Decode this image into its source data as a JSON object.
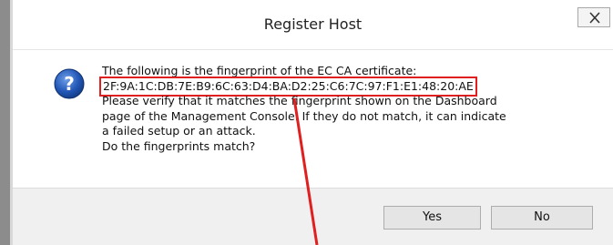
{
  "dialog": {
    "title": "Register Host",
    "close_symbol": "X",
    "icon": "question-icon",
    "message_lines": [
      "The following is the fingerprint of the EC CA certificate:",
      "2F:9A:1C:DB:7E:B9:6C:63:D4:BA:D2:25:C6:7C:97:F1:E1:48:20:AE",
      "Please verify that it matches the fingerprint shown on the Dashboard",
      "page of the Management Console. If they do not match, it can indicate",
      "a failed setup or an attack.",
      "Do the fingerprints match?"
    ],
    "buttons": {
      "yes": "Yes",
      "no": "No"
    }
  },
  "colors": {
    "highlight": "#e02020",
    "icon_blue": "#1f4fa8"
  }
}
